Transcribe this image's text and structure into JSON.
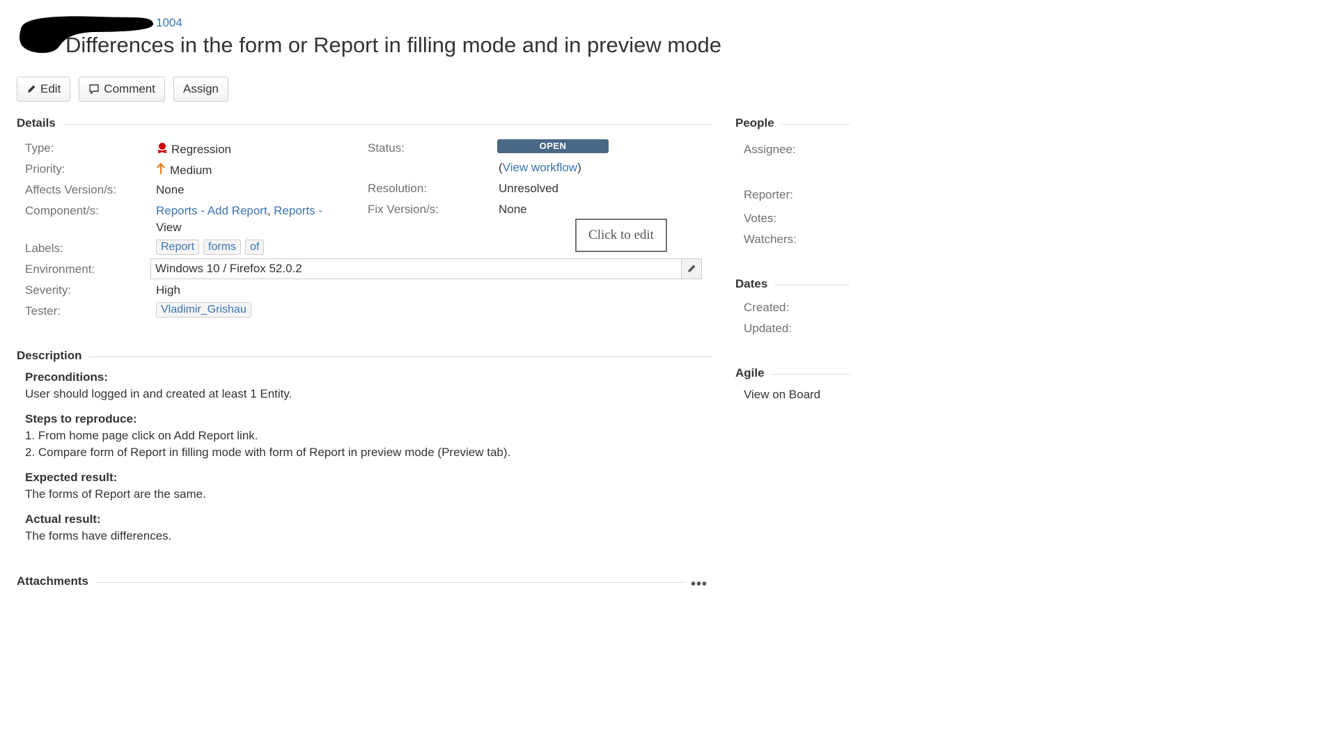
{
  "issue": {
    "key_suffix": "1004",
    "title": "Differences in the form or Report in filling mode and in preview mode"
  },
  "toolbar": {
    "edit_label": "Edit",
    "comment_label": "Comment",
    "assign_label": "Assign"
  },
  "details": {
    "heading": "Details",
    "type_label": "Type:",
    "type_value": "Regression",
    "priority_label": "Priority:",
    "priority_value": "Medium",
    "affects_label": "Affects Version/s:",
    "affects_value": "None",
    "components_label": "Component/s:",
    "components": [
      "Reports - Add Report",
      "Reports -",
      "View"
    ],
    "labels_label": "Labels:",
    "labels": [
      "Report",
      "forms",
      "of"
    ],
    "environment_label": "Environment:",
    "environment_value": "Windows 10 / Firefox 52.0.2",
    "severity_label": "Severity:",
    "severity_value": "High",
    "tester_label": "Tester:",
    "tester_value": "Vladimir_Grishau",
    "status_label": "Status:",
    "status_value": "OPEN",
    "workflow_open": "(",
    "workflow_link": "View workflow",
    "workflow_close": ")",
    "resolution_label": "Resolution:",
    "resolution_value": "Unresolved",
    "fix_label": "Fix Version/s:",
    "fix_value": "None",
    "tooltip": "Click to edit"
  },
  "description": {
    "heading": "Description",
    "preconditions_heading": "Preconditions:",
    "preconditions_text": "User should logged in and created at least 1 Entity.",
    "steps_heading": "Steps to reproduce:",
    "steps": [
      "1. From home page click on Add Report link.",
      "2. Compare form of Report in filling mode with form of Report in preview mode (Preview tab)."
    ],
    "expected_heading": "Expected result:",
    "expected_text": "The forms of Report are the same.",
    "actual_heading": "Actual result:",
    "actual_text": "The forms have differences."
  },
  "attachments": {
    "heading": "Attachments",
    "more": "•••"
  },
  "people": {
    "heading": "People",
    "assignee_label": "Assignee:",
    "reporter_label": "Reporter:",
    "votes_label": "Votes:",
    "watchers_label": "Watchers:"
  },
  "dates": {
    "heading": "Dates",
    "created_label": "Created:",
    "updated_label": "Updated:"
  },
  "agile": {
    "heading": "Agile",
    "view_on_board": "View on Board"
  },
  "colors": {
    "link": "#3b73af",
    "status_open": "#4a6785",
    "priority_medium": "#e67e22",
    "type_regression": "#cc0000"
  },
  "icons": {
    "edit": "pencil-icon",
    "comment": "speech-bubble-icon",
    "type": "regression-bug-icon",
    "priority": "arrow-up-icon",
    "env_edit": "pencil-icon"
  }
}
